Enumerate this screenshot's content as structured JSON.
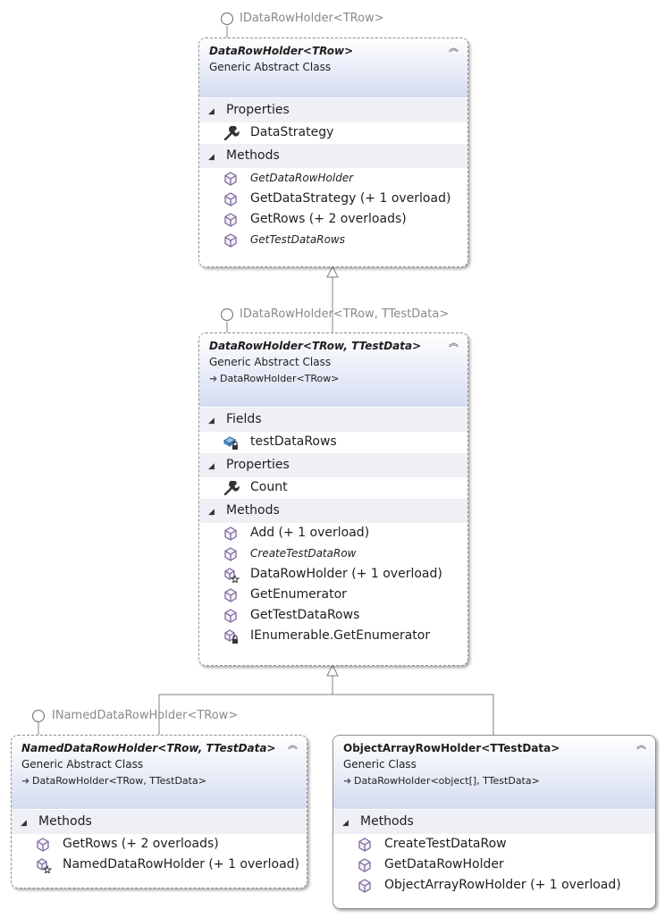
{
  "interfaces": {
    "i1": "IDataRowHolder<TRow>",
    "i2": "IDataRowHolder<TRow, TTestData>",
    "i3": "INamedDataRowHolder<TRow>"
  },
  "box1": {
    "name": "DataRowHolder",
    "tparams": "<TRow>",
    "kind": "Generic Abstract Class",
    "sections": {
      "properties": "Properties",
      "methods": "Methods"
    },
    "properties": [
      "DataStrategy"
    ],
    "methods": [
      "GetDataRowHolder",
      "GetDataStrategy (+ 1 overload)",
      "GetRows (+ 2 overloads)",
      "GetTestDataRows"
    ]
  },
  "box2": {
    "name": "DataRowHolder",
    "tparams": "<TRow, TTestData>",
    "kind": "Generic Abstract Class",
    "base": "DataRowHolder<TRow>",
    "sections": {
      "fields": "Fields",
      "properties": "Properties",
      "methods": "Methods"
    },
    "fields": [
      "testDataRows"
    ],
    "properties": [
      "Count"
    ],
    "methods": [
      "Add (+ 1 overload)",
      "CreateTestDataRow",
      "DataRowHolder (+ 1 overload)",
      "GetEnumerator",
      "GetTestDataRows",
      "IEnumerable.GetEnumerator"
    ]
  },
  "box3": {
    "name": "NamedDataRowHolder",
    "tparams": "<TRow, TTestData>",
    "kind": "Generic Abstract Class",
    "base": "DataRowHolder<TRow, TTestData>",
    "sections": {
      "methods": "Methods"
    },
    "methods": [
      "GetRows (+ 2 overloads)",
      "NamedDataRowHolder (+ 1 overload)"
    ]
  },
  "box4": {
    "name": "ObjectArrayRowHolder",
    "tparams": "<TTestData>",
    "kind": "Generic Class",
    "base": "DataRowHolder<object[], TTestData>",
    "sections": {
      "methods": "Methods"
    },
    "methods": [
      "CreateTestDataRow",
      "GetDataRowHolder",
      "ObjectArrayRowHolder (+ 1 overload)"
    ]
  },
  "icons": {
    "property": "wrench-icon",
    "method": "cube-icon",
    "field": "field-lock-icon",
    "constructor": "cube-star-icon",
    "private-method": "cube-lock-icon",
    "collapse": "double-chevron-up-icon",
    "expand-section": "triangle-down-icon",
    "base-arrow": "inherit-arrow-icon",
    "interface": "lollipop-icon"
  },
  "colors": {
    "header_gradient_end": "#d5dcf1",
    "section_bg": "#eef0f6",
    "cube_icon": "#7c6a9e",
    "connector": "#808080"
  }
}
